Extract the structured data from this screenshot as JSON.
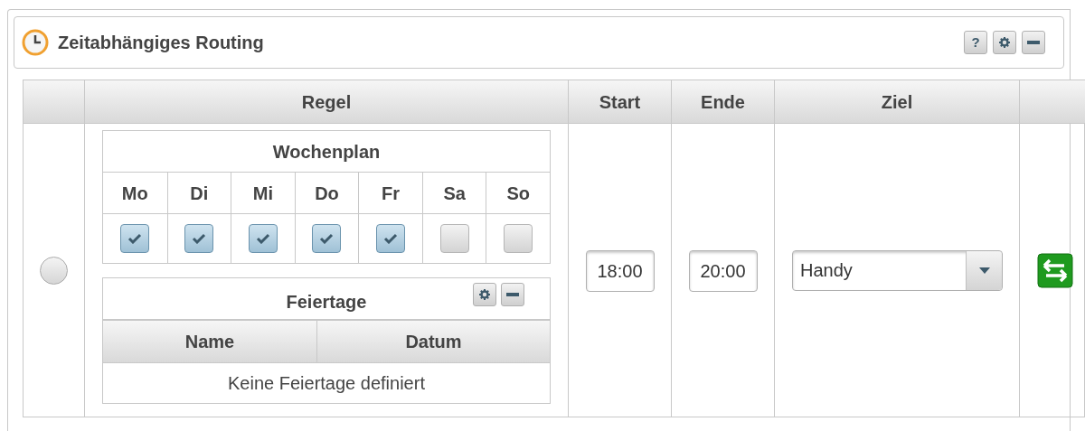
{
  "panel": {
    "title": "Zeitabhängiges Routing",
    "buttons": [
      {
        "kind": "help",
        "label": "?"
      },
      {
        "kind": "settings"
      },
      {
        "kind": "collapse"
      }
    ]
  },
  "table": {
    "columns": [
      "Regel",
      "Start",
      "Ende",
      "Ziel"
    ],
    "rows": [
      {
        "selected": false,
        "weekplan": {
          "title": "Wochenplan",
          "days": [
            {
              "label": "Mo",
              "checked": true
            },
            {
              "label": "Di",
              "checked": true
            },
            {
              "label": "Mi",
              "checked": true
            },
            {
              "label": "Do",
              "checked": true
            },
            {
              "label": "Fr",
              "checked": true
            },
            {
              "label": "Sa",
              "checked": false
            },
            {
              "label": "So",
              "checked": false
            }
          ]
        },
        "holidays": {
          "title": "Feiertage",
          "buttons": [
            {
              "kind": "settings"
            },
            {
              "kind": "collapse"
            }
          ],
          "columns": [
            "Name",
            "Datum"
          ],
          "empty_text": "Keine Feiertage definiert"
        },
        "start": "18:00",
        "end": "20:00",
        "target": "Handy"
      }
    ]
  }
}
